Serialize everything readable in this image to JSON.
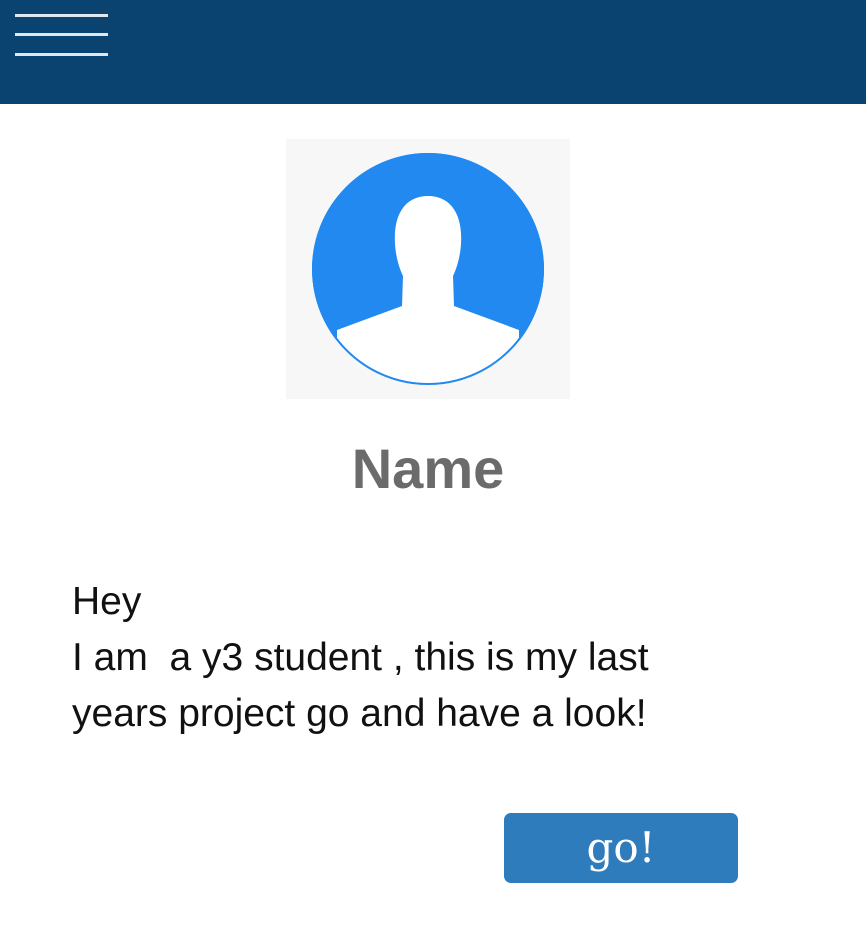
{
  "header": {
    "menu_icon": "hamburger-menu-icon",
    "background_color": "#0a4370"
  },
  "profile": {
    "avatar_icon": "user-silhouette-icon",
    "avatar_color": "#2289f0",
    "name": "Name",
    "bio_lines": [
      "Hey",
      "I am  a y3 student , this is my last",
      "years project go and have a look!"
    ]
  },
  "actions": {
    "go_label": "go!",
    "go_color": "#2f7cbd"
  }
}
